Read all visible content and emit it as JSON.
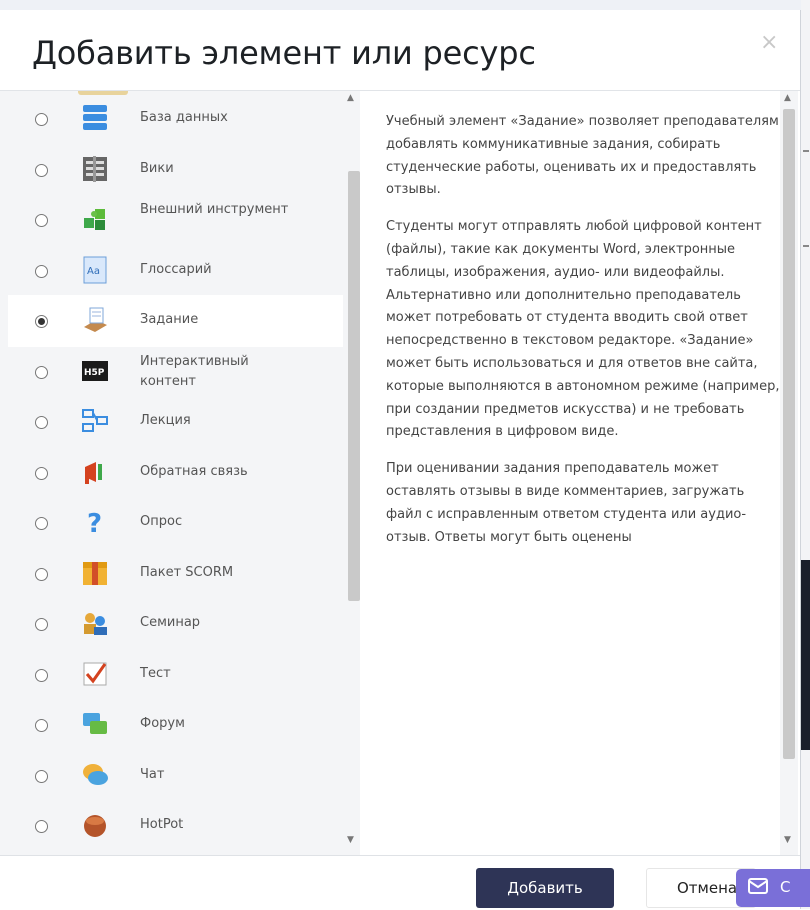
{
  "modal": {
    "title": "Добавить элемент или ресурс",
    "close_label": "×"
  },
  "options": [
    {
      "label": "База данных",
      "icon": "database-icon",
      "selected": false
    },
    {
      "label": "Вики",
      "icon": "wiki-icon",
      "selected": false
    },
    {
      "label": "Внешний инструмент",
      "icon": "puzzle-icon",
      "selected": false
    },
    {
      "label": "Глоссарий",
      "icon": "glossary-icon",
      "selected": false
    },
    {
      "label": "Задание",
      "icon": "assignment-icon",
      "selected": true
    },
    {
      "label": "Интерактивный контент",
      "icon": "h5p-icon",
      "selected": false
    },
    {
      "label": "Лекция",
      "icon": "lesson-icon",
      "selected": false
    },
    {
      "label": "Обратная связь",
      "icon": "megaphone-icon",
      "selected": false
    },
    {
      "label": "Опрос",
      "icon": "question-icon",
      "selected": false
    },
    {
      "label": "Пакет SCORM",
      "icon": "scorm-package-icon",
      "selected": false
    },
    {
      "label": "Семинар",
      "icon": "workshop-icon",
      "selected": false
    },
    {
      "label": "Тест",
      "icon": "quiz-icon",
      "selected": false
    },
    {
      "label": "Форум",
      "icon": "forum-icon",
      "selected": false
    },
    {
      "label": "Чат",
      "icon": "chat-icon",
      "selected": false
    },
    {
      "label": "HotPot",
      "icon": "hotpot-icon",
      "selected": false
    }
  ],
  "description": {
    "paragraphs": [
      "Учебный элемент «Задание» позволяет преподавателям добавлять коммуникативные задания, собирать студенческие работы, оценивать их и предоставлять отзывы.",
      "Студенты могут отправлять любой цифровой контент (файлы), такие как документы Word, электронные таблицы, изображения, аудио- или видеофайлы. Альтернативно или дополнительно преподаватель может потребовать от студента вводить свой ответ непосредственно в текстовом редакторе. «Задание» может быть использоваться и для ответов вне сайта, которые выполняются в автономном режиме (например, при создании предметов искусства) и не требовать представления в цифровом виде.",
      "При оценивании задания преподаватель может оставлять отзывы в виде комментариев, загружать файл с исправленным ответом студента или аудио-отзыв. Ответы могут быть оценены"
    ]
  },
  "footer": {
    "add_label": "Добавить",
    "cancel_label": "Отмена"
  },
  "feedback": {
    "label": "С"
  },
  "colors": {
    "primary_button": "#2e3456",
    "feedback_tab": "#7a6fd8",
    "selected_row": "#ffffff",
    "list_bg": "#f4f5f7"
  }
}
